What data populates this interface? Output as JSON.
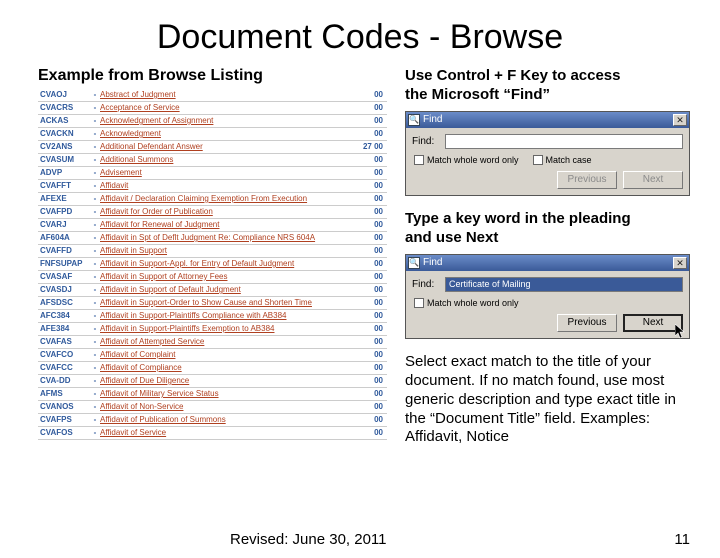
{
  "title": "Document Codes - Browse",
  "left_heading": "Example from Browse Listing",
  "listing": [
    {
      "code": "CVAOJ",
      "desc": "Abstract of Judgment",
      "num": "00"
    },
    {
      "code": "CVACRS",
      "desc": "Acceptance of Service",
      "num": "00"
    },
    {
      "code": "ACKAS",
      "desc": "Acknowledgment of Assignment",
      "num": "00"
    },
    {
      "code": "CVACKN",
      "desc": "Acknowledgment",
      "num": "00"
    },
    {
      "code": "CV2ANS",
      "desc": "Additional Defendant Answer",
      "num": "27 00"
    },
    {
      "code": "CVASUM",
      "desc": "Additional Summons",
      "num": "00"
    },
    {
      "code": "ADVP",
      "desc": "Advisement",
      "num": "00"
    },
    {
      "code": "CVAFFT",
      "desc": "Affidavit",
      "num": "00"
    },
    {
      "code": "AFEXE",
      "desc": "Affidavit / Declaration Claiming Exemption From Execution",
      "num": "00"
    },
    {
      "code": "CVAFPD",
      "desc": "Affidavit for Order of Publication",
      "num": "00"
    },
    {
      "code": "CVARJ",
      "desc": "Affidavit for Renewal of Judgment",
      "num": "00"
    },
    {
      "code": "AF604A",
      "desc": "Affidavit in Spt of Deflt Judgment Re: Compliance NRS 604A",
      "num": "00"
    },
    {
      "code": "CVAFFD",
      "desc": "Affidavit in Support",
      "num": "00"
    },
    {
      "code": "FNFSUPAP",
      "desc": "Affidavit in Support-Appl. for Entry of Default Judgment",
      "num": "00"
    },
    {
      "code": "CVASAF",
      "desc": "Affidavit in Support of Attorney Fees",
      "num": "00"
    },
    {
      "code": "CVASDJ",
      "desc": "Affidavit in Support of Default Judgment",
      "num": "00"
    },
    {
      "code": "AFSDSC",
      "desc": "Affidavit in Support-Order to Show Cause and Shorten Time",
      "num": "00"
    },
    {
      "code": "AFC384",
      "desc": "Affidavit in Support-Plaintiffs Compliance with AB384",
      "num": "00"
    },
    {
      "code": "AFE384",
      "desc": "Affidavit in Support-Plaintiffs Exemption to AB384",
      "num": "00"
    },
    {
      "code": "CVAFAS",
      "desc": "Affidavit of Attempted Service",
      "num": "00"
    },
    {
      "code": "CVAFCO",
      "desc": "Affidavit of Complaint",
      "num": "00"
    },
    {
      "code": "CVAFCC",
      "desc": "Affidavit of Compliance",
      "num": "00"
    },
    {
      "code": "CVA-DD",
      "desc": "Affidavit of Due Diligence",
      "num": "00"
    },
    {
      "code": "AFMS",
      "desc": "Affidavit of Military Service Status",
      "num": "00"
    },
    {
      "code": "CVANOS",
      "desc": "Affidavit of Non-Service",
      "num": "00"
    },
    {
      "code": "CVAFPS",
      "desc": "Affidavit of Publication of Summons",
      "num": "00"
    },
    {
      "code": "CVAFOS",
      "desc": "Affidavit of Service",
      "num": "00"
    }
  ],
  "right": {
    "intro1_l1": "Use Control + F Key to access",
    "intro1_l2": "the Microsoft “Find”",
    "intro2_l1": "Type a key word in the pleading",
    "intro2_l2": "and use Next",
    "final": "Select exact match to the title of your document.  If no match found, use most generic description and type exact title in the “Document Title” field.  Examples:  Affidavit, Notice"
  },
  "find": {
    "title": "Find",
    "label": "Find:",
    "value_empty": "",
    "value_filled": "Certificate of Mailing",
    "whole_word": "Match whole word only",
    "match_case": "Match case",
    "prev": "Previous",
    "next": "Next"
  },
  "footer": {
    "revised": "Revised: June 30, 2011",
    "page": "11"
  }
}
